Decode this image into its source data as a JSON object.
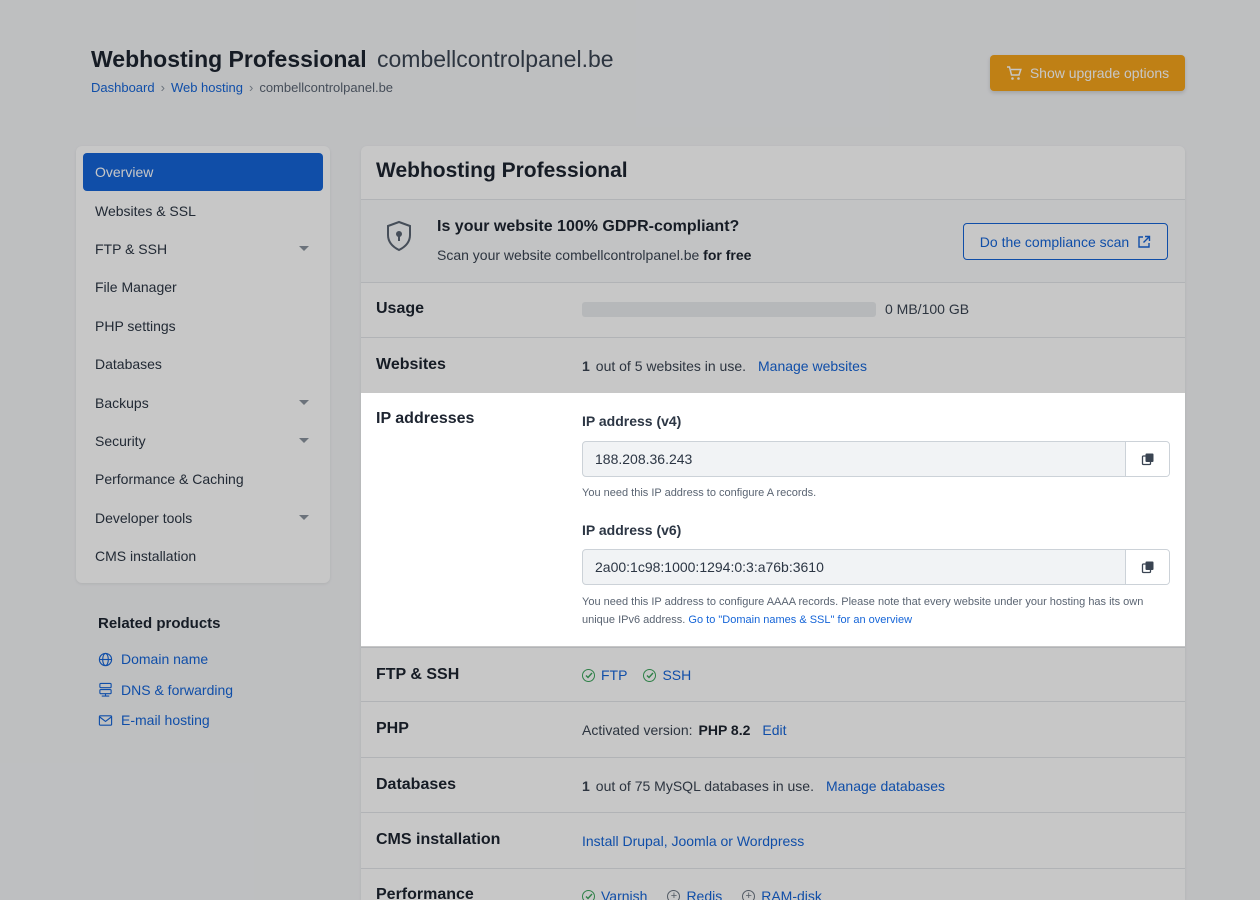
{
  "header": {
    "title": "Webhosting Professional",
    "domain": "combellcontrolpanel.be",
    "breadcrumbs": [
      "Dashboard",
      "Web hosting",
      "combellcontrolpanel.be"
    ],
    "breadcrumb_sep": "›"
  },
  "upgrade_button": "Show upgrade options",
  "sidebar": {
    "items": [
      {
        "label": "Overview",
        "active": true
      },
      {
        "label": "Websites & SSL"
      },
      {
        "label": "FTP & SSH",
        "caret": true
      },
      {
        "label": "File Manager"
      },
      {
        "label": "PHP settings"
      },
      {
        "label": "Databases"
      },
      {
        "label": "Backups",
        "caret": true
      },
      {
        "label": "Security",
        "caret": true
      },
      {
        "label": "Performance & Caching"
      },
      {
        "label": "Developer tools",
        "caret": true
      },
      {
        "label": "CMS installation"
      }
    ]
  },
  "related": {
    "title": "Related products",
    "items": [
      {
        "label": "Domain name",
        "icon": "globe-icon"
      },
      {
        "label": "DNS & forwarding",
        "icon": "dns-icon"
      },
      {
        "label": "E-mail hosting",
        "icon": "mail-icon"
      }
    ]
  },
  "card": {
    "title": "Webhosting Professional",
    "gdpr": {
      "title": "Is your website 100% GDPR-compliant?",
      "sub_prefix": "Scan your website combellcontrolpanel.be",
      "sub_bold": "for free",
      "button": "Do the compliance scan"
    },
    "usage": {
      "label": "Usage",
      "value": "0 MB/100 GB",
      "fraction": 0
    },
    "websites": {
      "label": "Websites",
      "count": "1",
      "text": "out of 5 websites in use.",
      "link": "Manage websites"
    },
    "ip": {
      "label": "IP addresses",
      "v4_label": "IP address (v4)",
      "v4": "188.208.36.243",
      "v4_help": "You need this IP address to configure A records.",
      "v6_label": "IP address (v6)",
      "v6": "2a00:1c98:1000:1294:0:3:a76b:3610",
      "v6_help": "You need this IP address to configure AAAA records. Please note that every website under your hosting has its own unique IPv6 address.",
      "v6_link": "Go to \"Domain names & SSL\" for an overview"
    },
    "ftp": {
      "label": "FTP & SSH",
      "items": [
        "FTP",
        "SSH"
      ]
    },
    "php": {
      "label": "PHP",
      "prefix": "Activated version:",
      "version": "PHP 8.2",
      "link": "Edit"
    },
    "databases": {
      "label": "Databases",
      "count": "1",
      "text": "out of 75 MySQL databases in use.",
      "link": "Manage databases"
    },
    "cms": {
      "label": "CMS installation",
      "link": "Install Drupal, Joomla or Wordpress"
    },
    "performance": {
      "label": "Performance",
      "items": [
        "Varnish",
        "Redis",
        "RAM-disk"
      ]
    }
  },
  "colors": {
    "accent": "#1565d8",
    "upgrade": "#f5a41c",
    "success": "#3ba55c"
  }
}
